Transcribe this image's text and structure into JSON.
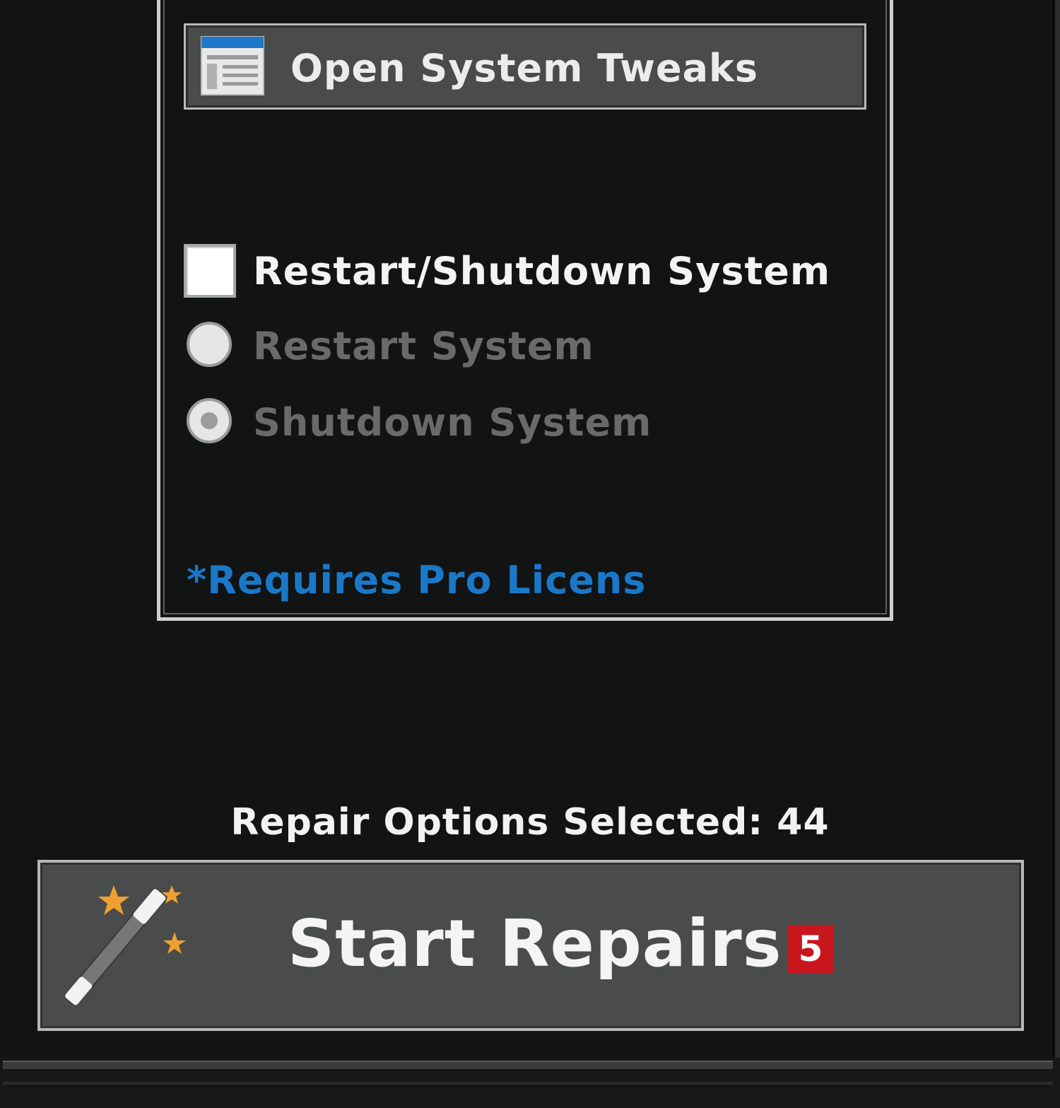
{
  "tweaks": {
    "label": "Open System Tweaks",
    "icon": "window-icon"
  },
  "restart_shutdown": {
    "label": "Restart/Shutdown System",
    "checked": false
  },
  "radio_options": [
    {
      "label": "Restart System",
      "selected": false,
      "enabled": false
    },
    {
      "label": "Shutdown System",
      "selected": true,
      "enabled": false
    }
  ],
  "pro_notice": "*Requires Pro Licens",
  "repair_count_text": "Repair Options Selected: 44",
  "start_button": {
    "label": "Start Repairs",
    "badge": "5",
    "icon": "magic-wand-icon"
  },
  "colors": {
    "background": "#121313",
    "button_bg": "#4a4b4b",
    "link_blue": "#1a78c8",
    "badge_red": "#c8161c",
    "disabled_text": "#6a6a6a"
  }
}
